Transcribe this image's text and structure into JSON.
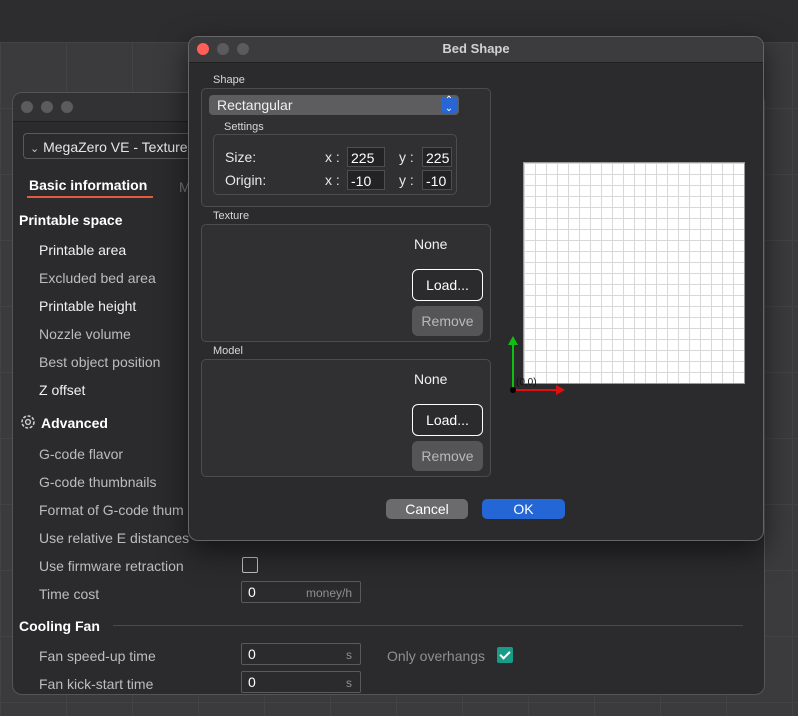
{
  "back_window": {
    "preset": "MegaZero VE - Texture",
    "tab_basic": "Basic information",
    "tab_next": "M",
    "sections": {
      "printable_space": "Printable space",
      "advanced": "Advanced",
      "cooling_fan": "Cooling Fan"
    },
    "items": {
      "printable_area": "Printable area",
      "excluded_bed_area": "Excluded bed area",
      "printable_height": "Printable height",
      "nozzle_volume": "Nozzle volume",
      "best_object_position": "Best object position",
      "z_offset": "Z offset",
      "gcode_flavor": "G-code flavor",
      "gcode_thumbnails": "G-code thumbnails",
      "format_thumbnails": "Format of G-code thum",
      "use_relative_e": "Use relative E distances",
      "use_firmware_retraction": "Use firmware retraction",
      "time_cost": "Time cost",
      "fan_speedup_time": "Fan speed-up time",
      "fan_kickstart_time": "Fan kick-start time",
      "only_overhangs": "Only overhangs"
    },
    "values": {
      "time_cost": "0",
      "time_cost_unit": "money/h",
      "fan_speedup": "0",
      "fan_speedup_unit": "s",
      "fan_kickstart": "0",
      "fan_kickstart_unit": "s"
    },
    "checkboxes": {
      "use_firmware_retraction": false,
      "only_overhangs": true
    }
  },
  "dialog": {
    "title": "Bed Shape",
    "shape_label": "Shape",
    "shape_value": "Rectangular",
    "settings_label": "Settings",
    "size_label": "Size:",
    "origin_label": "Origin:",
    "x_label": "x :",
    "y_label": "y :",
    "size_x": "225",
    "size_y": "225",
    "origin_x": "-10",
    "origin_y": "-10",
    "texture_label": "Texture",
    "texture_value": "None",
    "model_label": "Model",
    "model_value": "None",
    "load_label": "Load...",
    "remove_label": "Remove",
    "cancel_label": "Cancel",
    "ok_label": "OK",
    "origin_marker": "(0,0)"
  },
  "colors": {
    "accent": "#2566d7",
    "tab_underline": "#e25c3c",
    "checkbox_on": "#169c87",
    "axis_x": "#e01010",
    "axis_y": "#10c010"
  }
}
